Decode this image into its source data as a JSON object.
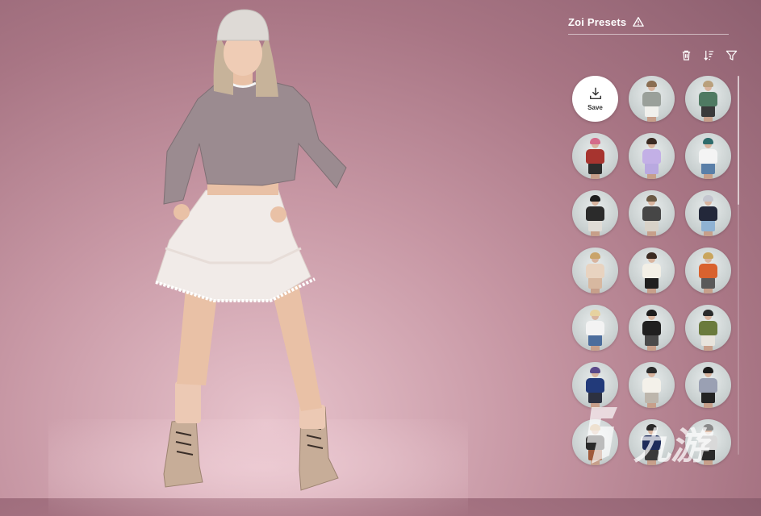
{
  "panel": {
    "title": "Zoi Presets",
    "title_icon": "warning-triangle-icon",
    "toolbar": [
      {
        "name": "delete-button",
        "icon": "trash-icon"
      },
      {
        "name": "sort-button",
        "icon": "sort-icon"
      },
      {
        "name": "filter-button",
        "icon": "filter-icon"
      }
    ],
    "save_label": "Save",
    "save_icon": "download-icon"
  },
  "presets": [
    {
      "hair": "#8a6e52",
      "top": "#9aa09a",
      "bottom": "#f0f0ec"
    },
    {
      "hair": "#b9a07c",
      "top": "#4f7a62",
      "bottom": "#3a3a3a"
    },
    {
      "hair": "#d46b8a",
      "top": "#a7342f",
      "bottom": "#2d2d2d"
    },
    {
      "hair": "#3a2a22",
      "top": "#c3b0e6",
      "bottom": "#b9a9e0"
    },
    {
      "hair": "#2e6b6b",
      "top": "#f4f4f4",
      "bottom": "#5a7fa8"
    },
    {
      "hair": "#1c1c1c",
      "top": "#2b2b2b",
      "bottom": "#e0dcd6"
    },
    {
      "hair": "#6b5a45",
      "top": "#464646",
      "bottom": "#d8d2c8"
    },
    {
      "hair": "#c4c6cf",
      "top": "#23283a",
      "bottom": "#8fb2d3"
    },
    {
      "hair": "#c9a46a",
      "top": "#e8d3c0",
      "bottom": "#d7b8a0"
    },
    {
      "hair": "#3b2b22",
      "top": "#f2efe6",
      "bottom": "#1f1f1f"
    },
    {
      "hair": "#c9a55c",
      "top": "#d9622e",
      "bottom": "#5a5a5a"
    },
    {
      "hair": "#e6d2a0",
      "top": "#f3f3f3",
      "bottom": "#4c6d9c"
    },
    {
      "hair": "#1d1d1d",
      "top": "#202020",
      "bottom": "#4a4a4a"
    },
    {
      "hair": "#2b2b2b",
      "top": "#6a7a3c",
      "bottom": "#e8e4dc"
    },
    {
      "hair": "#5a4a8a",
      "top": "#223a7a",
      "bottom": "#2d3140"
    },
    {
      "hair": "#2a2a2a",
      "top": "#f4f1ea",
      "bottom": "#bdb6ac"
    },
    {
      "hair": "#1a1a1a",
      "top": "#9aa0b3",
      "bottom": "#232323"
    },
    {
      "hair": "#caa26c",
      "top": "#2a2a2a",
      "bottom": "#a05a3a"
    },
    {
      "hair": "#2a2a2a",
      "top": "#1e2b5a",
      "bottom": "#3b3b3b"
    },
    {
      "hair": "#8a8a8a",
      "top": "#d9d9d9",
      "bottom": "#2a2a2a"
    }
  ],
  "watermark": {
    "label": "九游",
    "logo": "9game-logo"
  }
}
